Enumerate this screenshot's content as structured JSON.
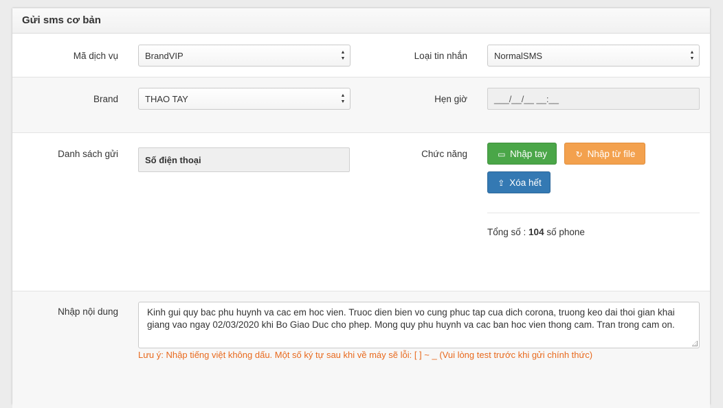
{
  "panel": {
    "title": "Gửi sms cơ bản"
  },
  "row1": {
    "service_label": "Mã dịch vụ",
    "service_value": "BrandVIP",
    "msgtype_label": "Loại tin nhắn",
    "msgtype_value": "NormalSMS"
  },
  "row2": {
    "brand_label": "Brand",
    "brand_value": "THAO TAY",
    "schedule_label": "Hẹn giờ",
    "schedule_value": "___/__/__ __:__"
  },
  "row3": {
    "list_label": "Danh sách gửi",
    "list_header": "Số điện thoại",
    "function_label": "Chức năng",
    "btn_manual": "Nhập tay",
    "btn_file": "Nhập từ file",
    "btn_clear": "Xóa hết",
    "total_prefix": "Tổng số :",
    "total_count": "104",
    "total_suffix": "số phone"
  },
  "row4": {
    "content_label": "Nhập nội dung",
    "content_value": "Kinh gui quy bac phu huynh va cac em hoc vien. Truoc dien bien vo cung phuc tap cua dich corona, truong keo dai thoi gian khai giang vao ngay 02/03/2020 khi Bo Giao Duc cho phep. Mong quy phu huynh va cac ban hoc vien thong cam. Tran trong cam on.",
    "note": "Lưu ý: Nhập tiếng việt không dấu. Một số ký tự sau khi về máy sẽ lỗi: [ ] ~ _ (Vui lòng test trước khi gửi chính thức)"
  },
  "colors": {
    "btn_green": "#4aa648",
    "btn_orange": "#f3a14e",
    "btn_blue": "#3479b3",
    "note": "#e8691d"
  },
  "icons": {
    "manual": "comment-icon",
    "file": "refresh-icon",
    "clear": "upload-icon",
    "select": "sort-arrows-icon"
  }
}
